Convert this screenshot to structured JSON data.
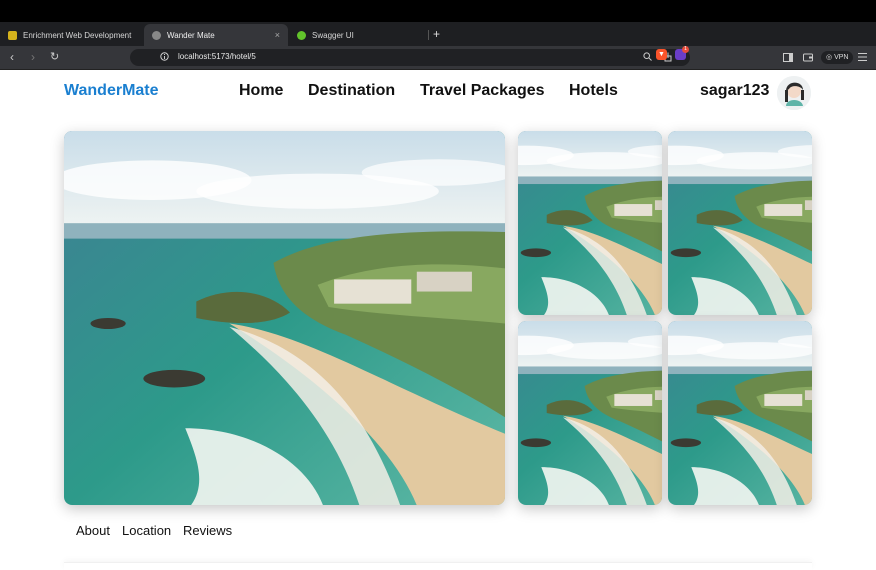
{
  "browser": {
    "tabs": [
      {
        "title": "Enrichment Web Development",
        "icon": "folder-icon"
      },
      {
        "title": "Wander Mate",
        "icon": "globe-icon",
        "close": "×"
      },
      {
        "title": "Swagger UI",
        "icon": "swagger-icon"
      }
    ],
    "new_tab": "+",
    "back": "‹",
    "forward": "›",
    "reload": "↻",
    "url": "localhost:5173/hotel/5",
    "vpn_label": "VPN",
    "rewards_count": "1",
    "accent": "#1a7fd0"
  },
  "header": {
    "brand": "WanderMate",
    "nav": [
      "Home",
      "Destination",
      "Travel Packages",
      "Hotels"
    ],
    "username": "sagar123"
  },
  "gallery": {
    "images": [
      "beach-aerial-main",
      "beach-aerial-1",
      "beach-aerial-2",
      "beach-aerial-3",
      "beach-aerial-4"
    ]
  },
  "detail_tabs": [
    "About",
    "Location",
    "Reviews"
  ]
}
